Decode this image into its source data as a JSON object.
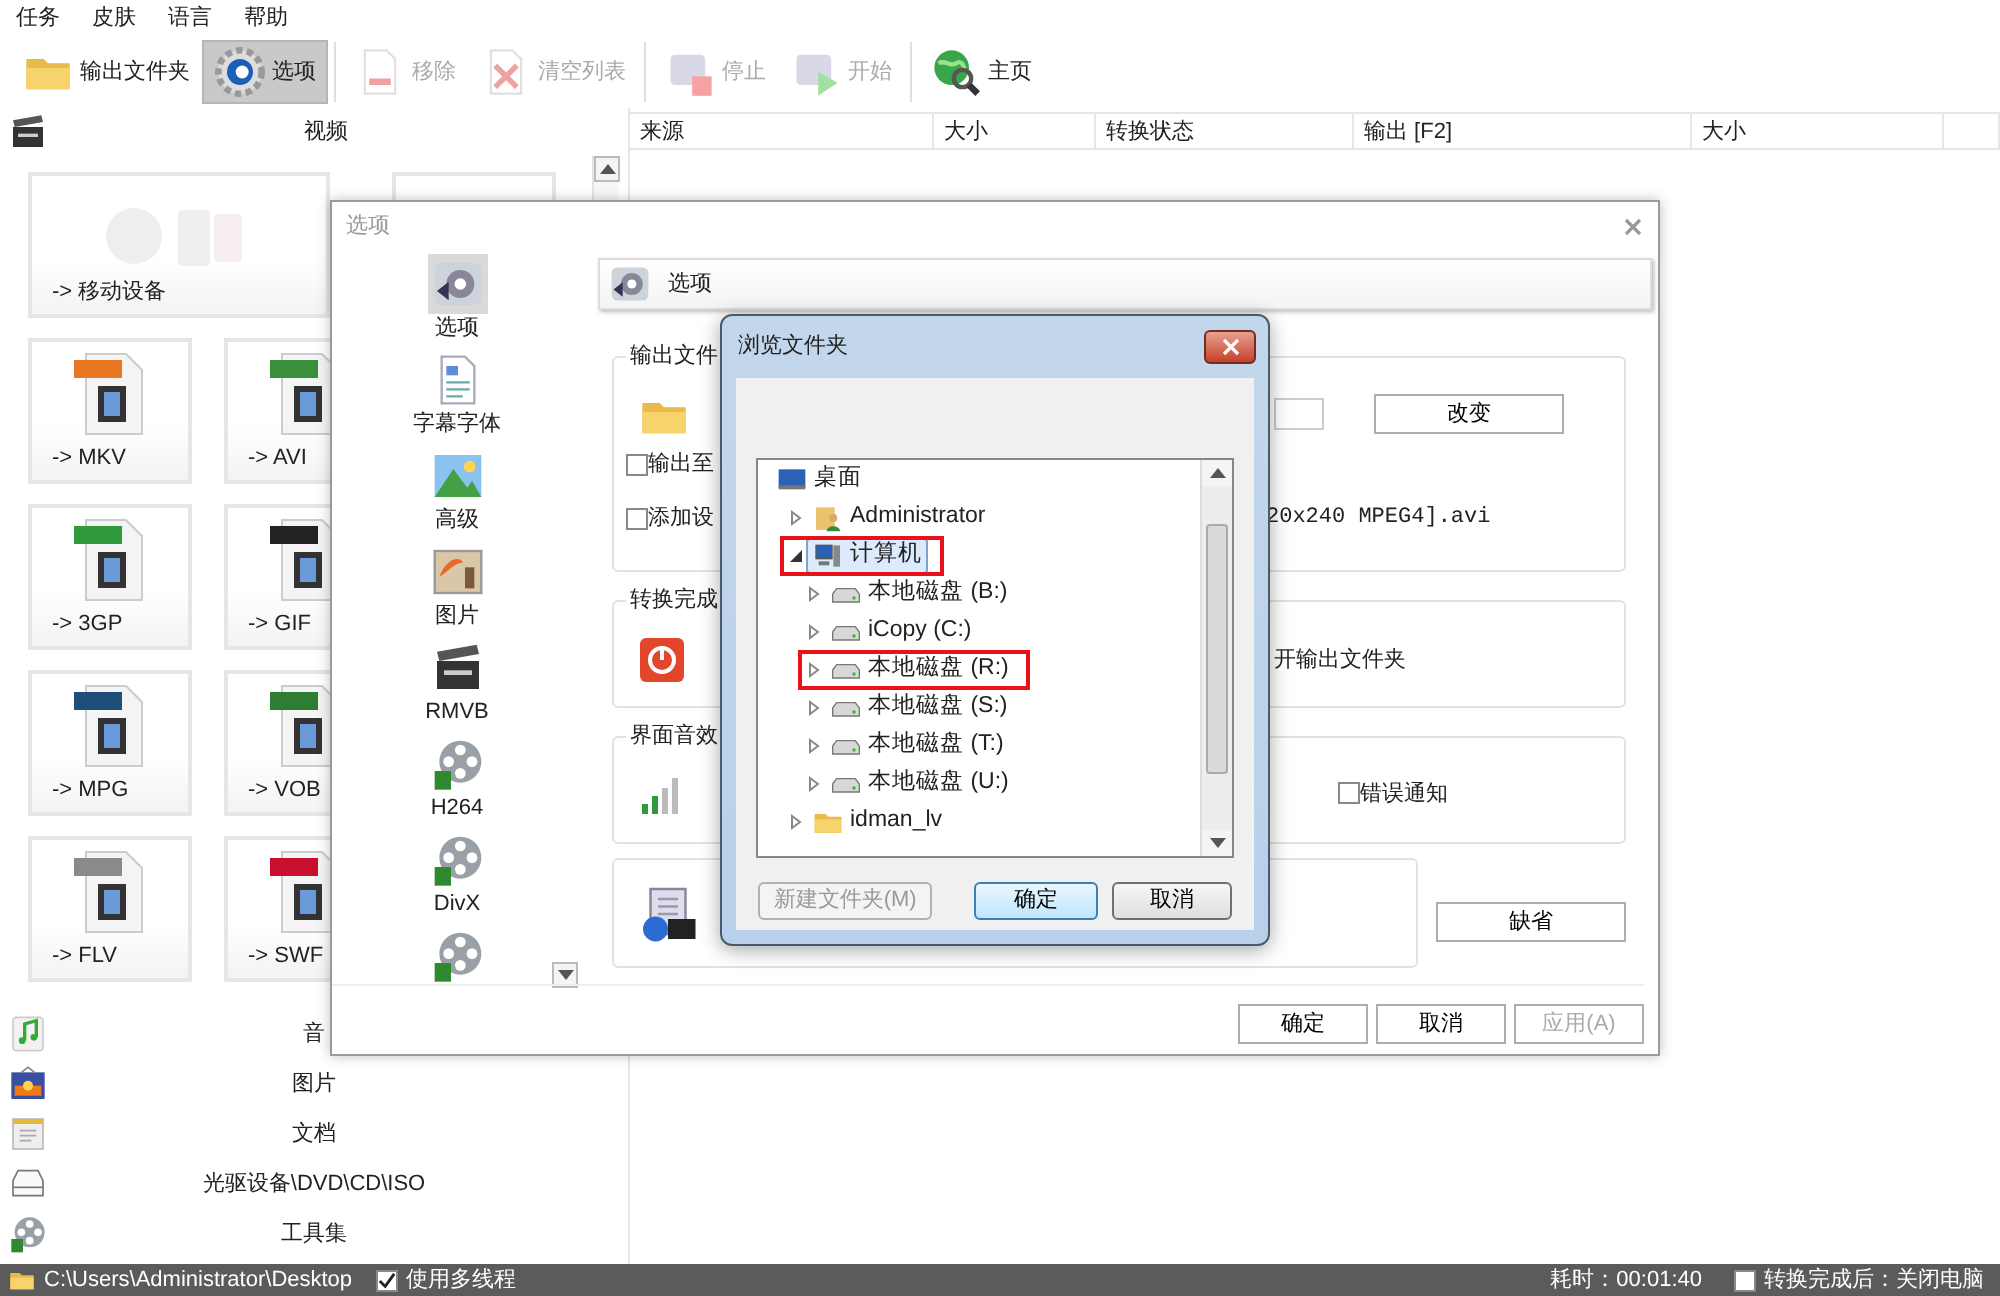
{
  "menu": [
    "任务",
    "皮肤",
    "语言",
    "帮助"
  ],
  "toolbar": [
    {
      "label": "输出文件夹",
      "kind": "folder",
      "disabled": false,
      "selected": false,
      "separator_after": false
    },
    {
      "label": "选项",
      "kind": "gear",
      "disabled": false,
      "selected": true,
      "separator_after": true
    },
    {
      "label": "移除",
      "kind": "remove",
      "disabled": true,
      "selected": false,
      "separator_after": false
    },
    {
      "label": "清空列表",
      "kind": "clear",
      "disabled": true,
      "selected": false,
      "separator_after": true
    },
    {
      "label": "停止",
      "kind": "stop",
      "disabled": true,
      "selected": false,
      "separator_after": false
    },
    {
      "label": "开始",
      "kind": "start",
      "disabled": true,
      "selected": false,
      "separator_after": true
    },
    {
      "label": "主页",
      "kind": "globe",
      "disabled": false,
      "selected": false,
      "separator_after": false
    }
  ],
  "left_panel": {
    "header": "视频",
    "tiles": [
      {
        "kind": "wide",
        "label": "-> 移动设备"
      },
      {
        "kind": "blank"
      },
      {
        "kind": "file",
        "label": "-> MKV",
        "color": "#e87722"
      },
      {
        "kind": "file",
        "label": "-> AVI",
        "color": "#3b8e3b"
      },
      {
        "kind": "file",
        "label": "-> 3GP",
        "color": "#2f9a3a"
      },
      {
        "kind": "file",
        "label": "-> GIF",
        "color": "#222222"
      },
      {
        "kind": "file",
        "label": "-> MPG",
        "color": "#1f4e79"
      },
      {
        "kind": "file",
        "label": "-> VOB",
        "color": "#2e7d32"
      },
      {
        "kind": "file",
        "label": "-> FLV",
        "color": "#8a8a8a"
      },
      {
        "kind": "file",
        "label": "-> SWF",
        "color": "#c8102e"
      }
    ],
    "categories": [
      {
        "label": "音",
        "kind": "music"
      },
      {
        "label": "图片",
        "kind": "picture"
      },
      {
        "label": "文档",
        "kind": "document"
      },
      {
        "label": "光驱设备\\DVD\\CD\\ISO",
        "kind": "drive"
      },
      {
        "label": "工具集",
        "kind": "reel"
      }
    ]
  },
  "table": {
    "columns": [
      "来源",
      "大小",
      "转换状态",
      "输出 [F2]",
      "大小"
    ]
  },
  "options_dialog": {
    "title": "选项",
    "nav": [
      {
        "label": "选项",
        "kind": "options",
        "selected": true
      },
      {
        "label": "字幕字体",
        "kind": "font",
        "selected": false
      },
      {
        "label": "高级",
        "kind": "landscape",
        "selected": false
      },
      {
        "label": "图片",
        "kind": "paint",
        "selected": false
      },
      {
        "label": "RMVB",
        "kind": "clapper",
        "selected": false
      },
      {
        "label": "H264",
        "kind": "reel",
        "selected": false
      },
      {
        "label": "DivX",
        "kind": "reel",
        "selected": false
      },
      {
        "kind": "reel",
        "selected": false
      }
    ],
    "header": "选项",
    "output_group": {
      "legend": "输出文件",
      "checkboxes": [
        {
          "label": "输出至",
          "checked": false
        },
        {
          "label": "添加设",
          "checked": false
        }
      ],
      "filename": "20x240 MPEG4].avi",
      "change_button": "改变"
    },
    "finish_group": {
      "legend": "转换完成",
      "option": "开输出文件夹"
    },
    "sound_group": {
      "legend": "界面音效",
      "error_notify": {
        "label": "错误通知",
        "checked": false
      }
    },
    "default_button": "缺省",
    "buttons": [
      {
        "label": "确定",
        "disabled": false
      },
      {
        "label": "取消",
        "disabled": false
      },
      {
        "label": "应用(A)",
        "disabled": true
      }
    ]
  },
  "browse_dialog": {
    "title": "浏览文件夹",
    "tree": [
      {
        "label": "桌面",
        "kind": "desktop",
        "selected": false,
        "highlighted": false,
        "children": [
          {
            "label": "Administrator",
            "kind": "user",
            "expanded": false,
            "selected": false,
            "highlighted": false
          },
          {
            "label": "计算机",
            "kind": "computer",
            "expanded": true,
            "selected": true,
            "highlighted": true,
            "children": [
              {
                "label": "本地磁盘 (B:)",
                "kind": "disk",
                "expanded": false,
                "selected": false,
                "highlighted": false
              },
              {
                "label": "iCopy (C:)",
                "kind": "disk",
                "expanded": false,
                "selected": false,
                "highlighted": false
              },
              {
                "label": "本地磁盘 (R:)",
                "kind": "disk",
                "expanded": false,
                "selected": false,
                "highlighted": true
              },
              {
                "label": "本地磁盘 (S:)",
                "kind": "disk",
                "expanded": false,
                "selected": false,
                "highlighted": false
              },
              {
                "label": "本地磁盘 (T:)",
                "kind": "disk",
                "expanded": false,
                "selected": false,
                "highlighted": false
              },
              {
                "label": "本地磁盘 (U:)",
                "kind": "disk",
                "expanded": false,
                "selected": false,
                "highlighted": false
              }
            ]
          },
          {
            "label": "idman_lv",
            "kind": "folder",
            "expanded": false,
            "selected": false,
            "highlighted": false
          }
        ]
      }
    ],
    "buttons": [
      {
        "label": "新建文件夹(M)",
        "disabled": true,
        "default": false
      },
      {
        "label": "确定",
        "disabled": false,
        "default": true
      },
      {
        "label": "取消",
        "disabled": false,
        "default": false
      }
    ]
  },
  "status_bar": {
    "path": "C:\\Users\\Administrator\\Desktop",
    "multithread": {
      "label": "使用多线程",
      "checked": true
    },
    "elapsed": "耗时：00:01:40",
    "shutdown": {
      "label": "转换完成后：关闭电脑",
      "checked": false
    }
  }
}
